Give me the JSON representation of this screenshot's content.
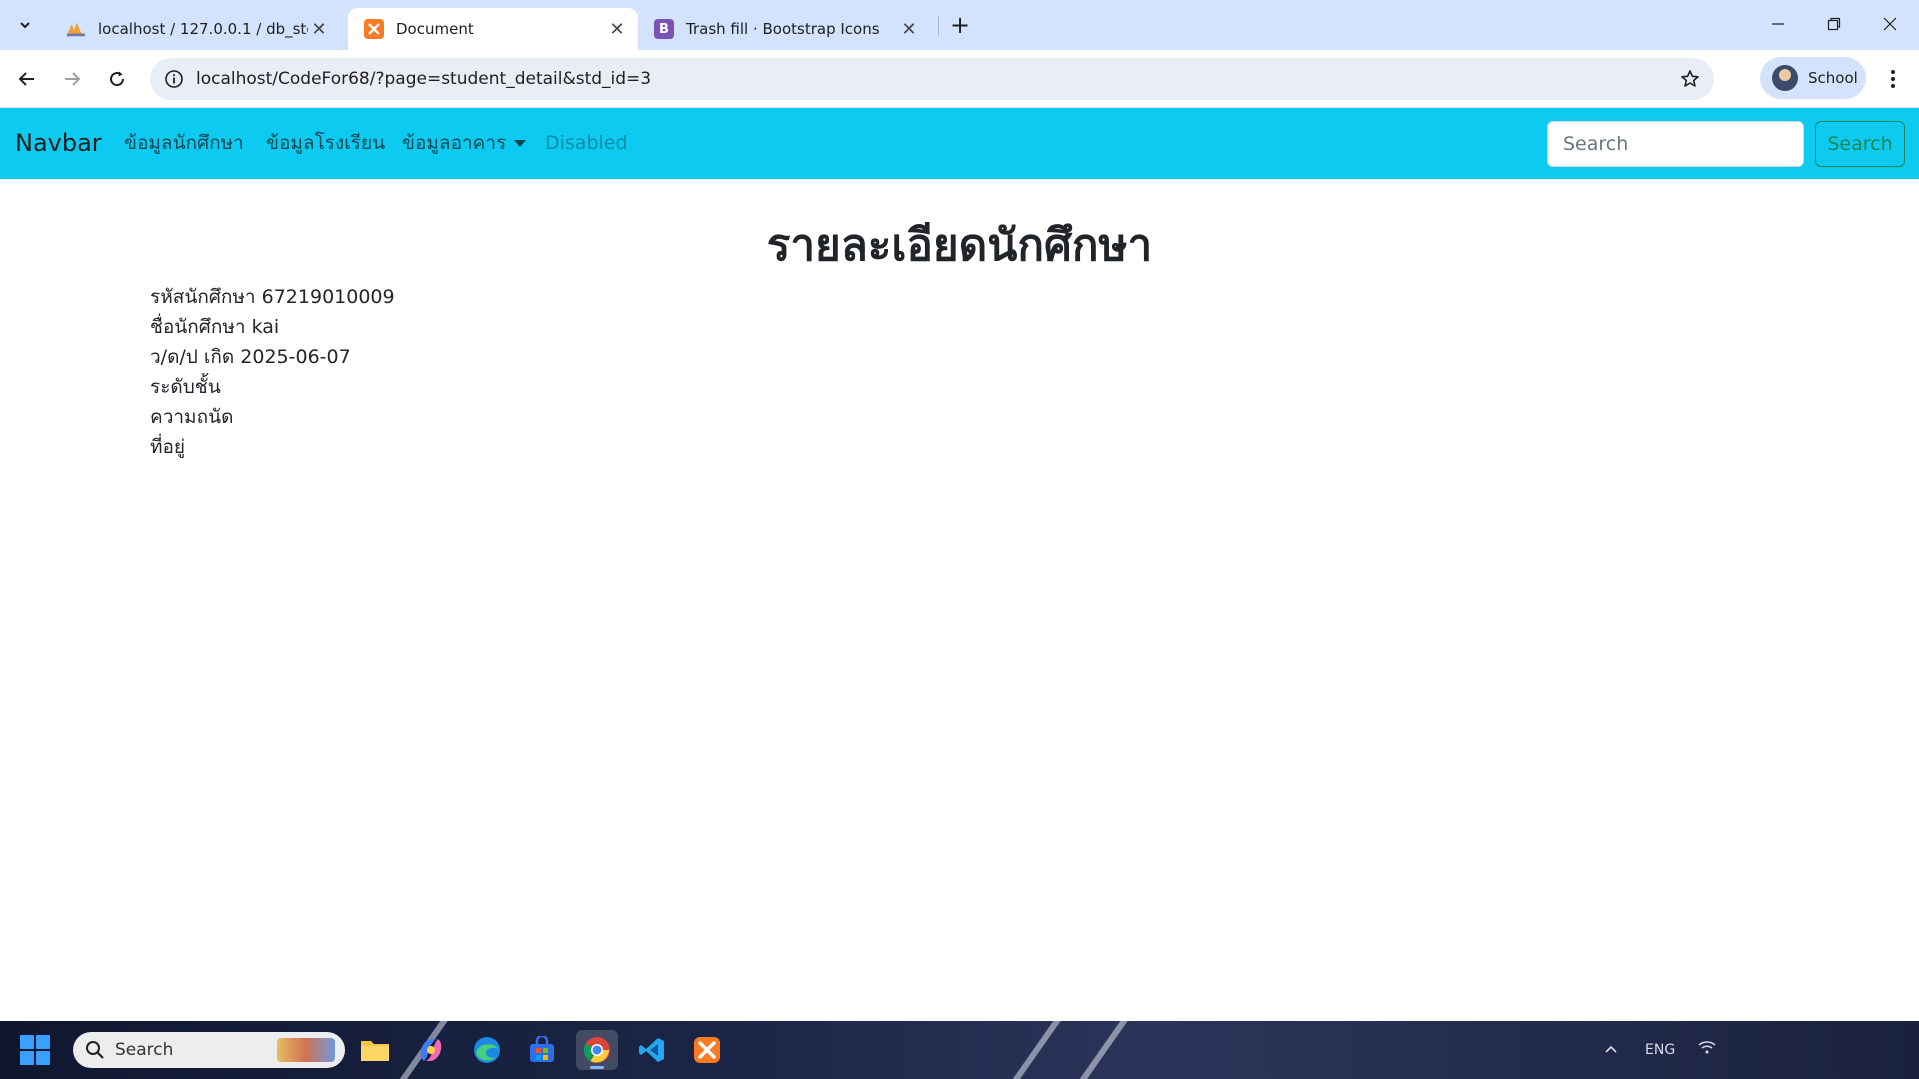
{
  "browser": {
    "tabs": [
      {
        "title": "localhost / 127.0.0.1 / db_std2_(",
        "favicon": "phpmyadmin-icon"
      },
      {
        "title": "Document",
        "favicon": "xampp-icon"
      },
      {
        "title": "Trash fill · Bootstrap Icons",
        "favicon": "bootstrap-icon",
        "favicon_letter": "B"
      }
    ],
    "active_tab": 1,
    "url": "localhost/CodeFor68/?page=student_detail&std_id=3",
    "profile_label": "School"
  },
  "navbar": {
    "brand": "Navbar",
    "links": [
      {
        "label": "ข้อมูลนักศึกษา"
      },
      {
        "label": "ข้อมูลโรงเรียน"
      },
      {
        "label": "ข้อมูลอาคาร"
      },
      {
        "label": "Disabled"
      }
    ],
    "search_placeholder": "Search",
    "search_button": "Search",
    "bg_color": "#0dcaf0"
  },
  "content": {
    "title": "รายละเอียดนักศึกษา",
    "fields": [
      {
        "label": "รหัสนักศึกษา",
        "value": "67219010009"
      },
      {
        "label": "ชื่อนักศึกษา",
        "value": "kai"
      },
      {
        "label": "ว/ด/ป เกิด",
        "value": "2025-06-07"
      },
      {
        "label": "ระดับชั้น",
        "value": ""
      },
      {
        "label": "ความถนัด",
        "value": ""
      },
      {
        "label": "ที่อยู่",
        "value": ""
      }
    ]
  },
  "taskbar": {
    "search_label": "Search",
    "language": "ENG",
    "apps": [
      "file-explorer-icon",
      "copilot-icon",
      "edge-icon",
      "store-icon",
      "chrome-icon",
      "vscode-icon",
      "xampp-icon"
    ]
  }
}
